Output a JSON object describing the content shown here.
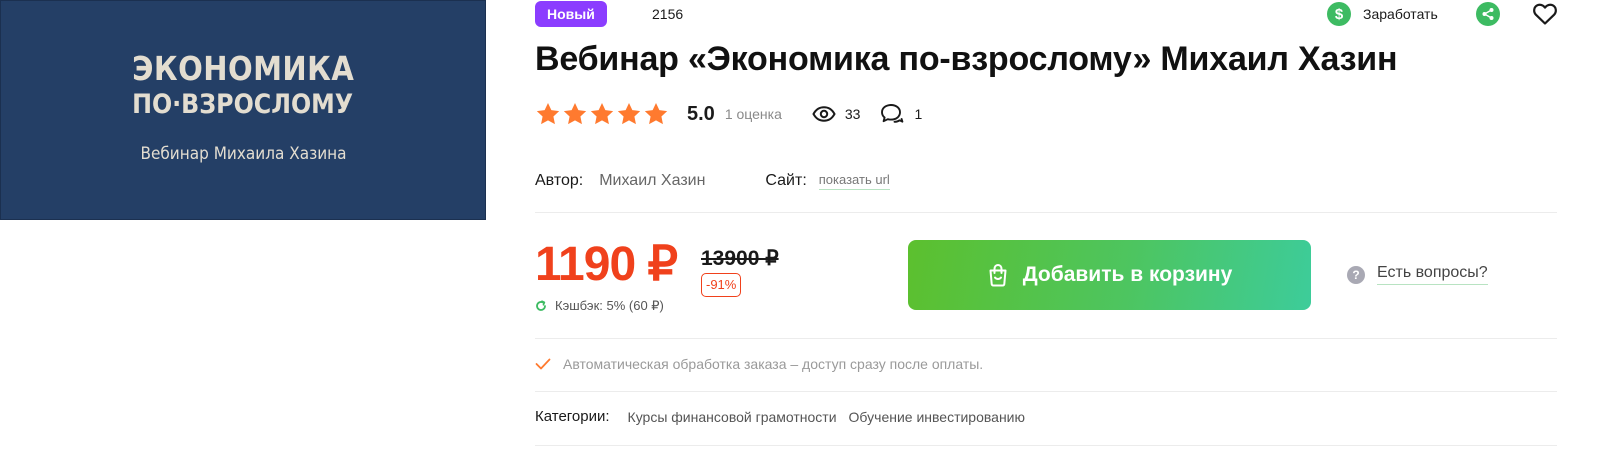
{
  "cover": {
    "line1": "ЭКОНОМИКА",
    "line2": "ПО·ВЗРОСЛОМУ",
    "line3": "Вебинар Михаила Хазина"
  },
  "header": {
    "badge": "Новый",
    "sku": "2156",
    "earn_label": "Заработать",
    "earn_icon": "$"
  },
  "product": {
    "title": "Вебинар «Экономика по-взрослому» Михаил Хазин",
    "rating_value": "5.0",
    "rating_stars": 5,
    "rating_count": "1 оценка",
    "views": "33",
    "comments": "1"
  },
  "meta": {
    "author_label": "Автор:",
    "author_value": "Михаил Хазин",
    "site_label": "Сайт:",
    "site_link": "показать url"
  },
  "pricing": {
    "price": "1190 ₽",
    "old_price": "13900 ₽",
    "discount": "-91%",
    "cashback": "Кэшбэк: 5% (60 ₽)"
  },
  "actions": {
    "add_to_cart": "Добавить в корзину",
    "questions": "Есть вопросы?",
    "question_icon": "?"
  },
  "info": {
    "auto_processing": "Автоматическая обработка заказа – доступ сразу после оплаты."
  },
  "categories": {
    "label": "Категории:",
    "items": [
      "Курсы финансовой грамотности",
      "Обучение инвестированию"
    ]
  },
  "colors": {
    "accent_green": "#3dbb62",
    "price_red": "#f0411c",
    "badge_purple": "#8b3dff",
    "star_orange": "#ff7a2f",
    "cover_blue": "#243f66"
  }
}
